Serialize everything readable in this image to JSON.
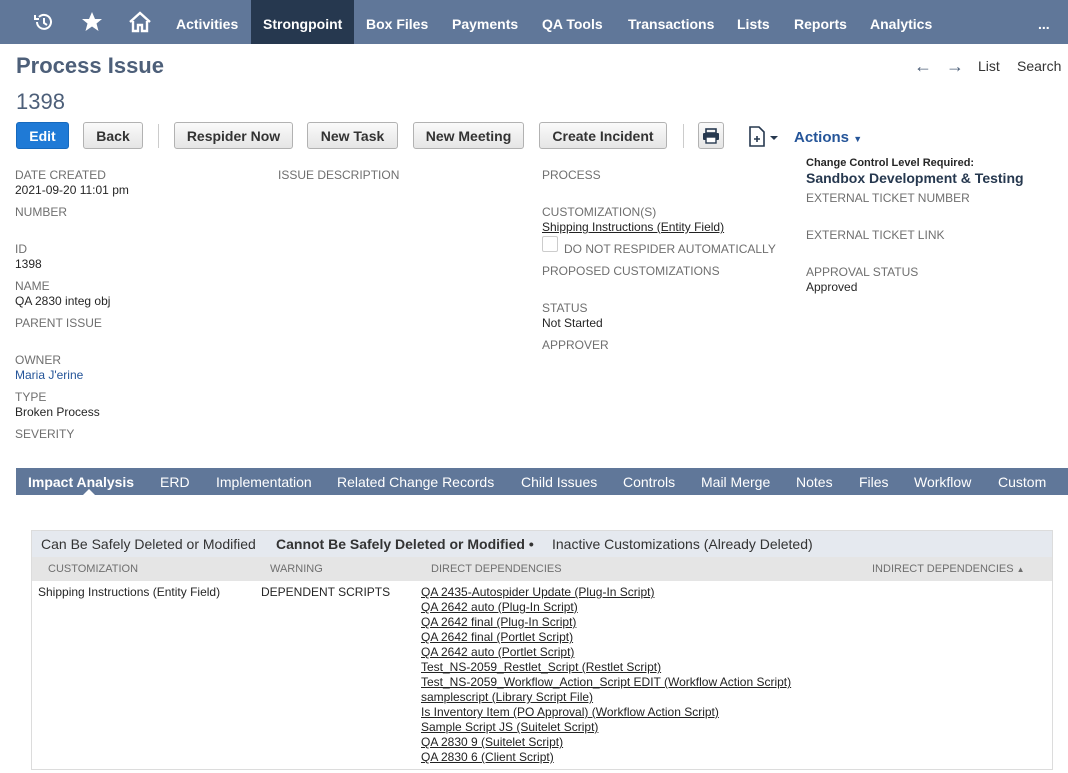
{
  "nav": {
    "items": [
      "Activities",
      "Strongpoint",
      "Box Files",
      "Payments",
      "QA Tools",
      "Transactions",
      "Lists",
      "Reports",
      "Analytics"
    ],
    "more": "..."
  },
  "header": {
    "title": "Process Issue",
    "record_number": "1398",
    "list_link": "List",
    "search_link": "Search"
  },
  "toolbar": {
    "edit": "Edit",
    "back": "Back",
    "respider": "Respider Now",
    "new_task": "New Task",
    "new_meeting": "New Meeting",
    "create_incident": "Create Incident",
    "actions": "Actions"
  },
  "fields": {
    "date_created_label": "DATE CREATED",
    "date_created": "2021-09-20 11:01 pm",
    "number_label": "NUMBER",
    "id_label": "ID",
    "id": "1398",
    "name_label": "NAME",
    "name": "QA 2830 integ obj",
    "parent_issue_label": "PARENT ISSUE",
    "owner_label": "OWNER",
    "owner": "Maria J'erine",
    "type_label": "TYPE",
    "type": "Broken Process",
    "severity_label": "SEVERITY",
    "issue_description_label": "ISSUE DESCRIPTION",
    "process_label": "PROCESS",
    "customizations_label": "CUSTOMIZATION(S)",
    "customization": "Shipping Instructions (Entity Field)",
    "no_respider_label": "DO NOT RESPIDER AUTOMATICALLY",
    "proposed_label": "PROPOSED CUSTOMIZATIONS",
    "status_label": "STATUS",
    "status": "Not Started",
    "approver_label": "APPROVER",
    "change_control_label": "Change Control Level Required:",
    "change_control": "Sandbox Development & Testing",
    "ext_ticket_number_label": "EXTERNAL TICKET NUMBER",
    "ext_ticket_link_label": "EXTERNAL TICKET LINK",
    "approval_status_label": "APPROVAL STATUS",
    "approval_status": "Approved"
  },
  "subtabs": [
    "Impact Analysis",
    "ERD",
    "Implementation",
    "Related Change Records",
    "Child Issues",
    "Controls",
    "Mail Merge",
    "Notes",
    "Files",
    "Workflow",
    "Custom"
  ],
  "impact": {
    "tabs": [
      "Can Be Safely Deleted or Modified",
      "Cannot Be Safely Deleted or Modified",
      "Inactive Customizations (Already Deleted)"
    ],
    "columns": [
      "CUSTOMIZATION",
      "WARNING",
      "DIRECT DEPENDENCIES",
      "INDIRECT DEPENDENCIES"
    ],
    "row": {
      "customization": "Shipping Instructions (Entity Field)",
      "warning": "DEPENDENT SCRIPTS",
      "dependencies": [
        "QA 2435-Autospider Update (Plug-In Script)",
        "QA 2642 auto (Plug-In Script)",
        "QA 2642 final (Plug-In Script)",
        "QA 2642 final (Portlet Script)",
        "QA 2642 auto (Portlet Script)",
        "Test_NS-2059_Restlet_Script (Restlet Script)",
        "Test_NS-2059_Workflow_Action_Script EDIT (Workflow Action Script)",
        "samplescript (Library Script File)",
        "Is Inventory Item (PO Approval) (Workflow Action Script)",
        "Sample Script JS (Suitelet Script)",
        "QA 2830 9 (Suitelet Script)",
        "QA 2830 6 (Client Script)"
      ]
    }
  },
  "colors": {
    "nav_bg": "#607799",
    "nav_active": "#26384f",
    "primary_button": "#1f7ad6",
    "title": "#4d5f79"
  }
}
